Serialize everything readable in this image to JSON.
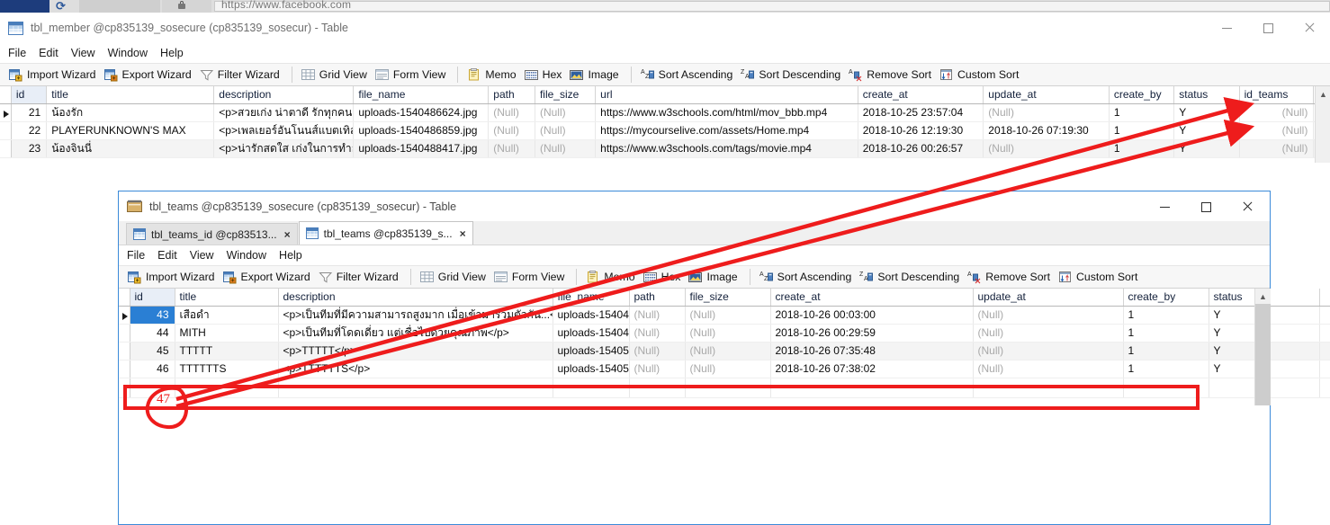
{
  "browser": {
    "url": "https://www.facebook.com"
  },
  "window1": {
    "title": "tbl_member @cp835139_sosecure (cp835139_sosecur) - Table",
    "icon": "table-icon",
    "controls": {
      "minimize": "minimize-icon",
      "maximize": "maximize-icon",
      "close": "close-icon"
    },
    "menu": [
      "File",
      "Edit",
      "View",
      "Window",
      "Help"
    ],
    "toolbar": [
      {
        "label": "Import Wizard",
        "icon": "import-wizard-icon"
      },
      {
        "label": "Export Wizard",
        "icon": "export-wizard-icon"
      },
      {
        "label": "Filter Wizard",
        "icon": "filter-icon"
      },
      {
        "sep": true
      },
      {
        "label": "Grid View",
        "icon": "grid-view-icon"
      },
      {
        "label": "Form View",
        "icon": "form-view-icon"
      },
      {
        "sep": true
      },
      {
        "label": "Memo",
        "icon": "memo-icon"
      },
      {
        "label": "Hex",
        "icon": "hex-icon"
      },
      {
        "label": "Image",
        "icon": "image-icon"
      },
      {
        "sep": true
      },
      {
        "label": "Sort Ascending",
        "icon": "sort-ascending-icon"
      },
      {
        "label": "Sort Descending",
        "icon": "sort-descending-icon"
      },
      {
        "label": "Remove Sort",
        "icon": "remove-sort-icon"
      },
      {
        "label": "Custom Sort",
        "icon": "custom-sort-icon"
      }
    ],
    "grid": {
      "columns": [
        "id",
        "title",
        "description",
        "file_name",
        "path",
        "file_size",
        "url",
        "create_at",
        "update_at",
        "create_by",
        "status",
        "id_teams"
      ],
      "rows": [
        {
          "marker": true,
          "id": "21",
          "title": "น้องรัก",
          "description": "<p>สวยเก่ง น่าตาดี รักทุกคนนะ",
          "file_name": "uploads-1540486624.jpg",
          "path": "(Null)",
          "file_size": "(Null)",
          "url": "https://www.w3schools.com/html/mov_bbb.mp4",
          "create_at": "2018-10-25 23:57:04",
          "update_at": "(Null)",
          "create_by": "1",
          "status": "Y",
          "id_teams": "(Null)"
        },
        {
          "marker": false,
          "id": "22",
          "title": "PLAYERUNKNOWN'S MAX",
          "description": "<p>เพลเยอร์อันโนนส์แบตเทิลกร",
          "file_name": "uploads-1540486859.jpg",
          "path": "(Null)",
          "file_size": "(Null)",
          "url": "https://mycourselive.com/assets/Home.mp4",
          "create_at": "2018-10-26 12:19:30",
          "update_at": "2018-10-26 07:19:30",
          "create_by": "1",
          "status": "Y",
          "id_teams": "(Null)"
        },
        {
          "marker": false,
          "id": "23",
          "title": "น้องจินนี่",
          "description": "<p>น่ารักสดใส เก่งในการทำอาห",
          "file_name": "uploads-1540488417.jpg",
          "path": "(Null)",
          "file_size": "(Null)",
          "url": "https://www.w3schools.com/tags/movie.mp4",
          "create_at": "2018-10-26 00:26:57",
          "update_at": "(Null)",
          "create_by": "1",
          "status": "Y",
          "id_teams": "(Null)"
        }
      ]
    }
  },
  "window2": {
    "title": "tbl_teams @cp835139_sosecure (cp835139_sosecur) - Table",
    "icon": "table-icon",
    "controls": {
      "minimize": "minimize-icon",
      "maximize": "maximize-icon",
      "close": "close-icon"
    },
    "tabs": [
      {
        "label": "tbl_teams_id @cp83513...",
        "active": false,
        "icon": "table-icon",
        "close": "×"
      },
      {
        "label": "tbl_teams @cp835139_s...",
        "active": true,
        "icon": "table-icon",
        "close": "×"
      }
    ],
    "menu": [
      "File",
      "Edit",
      "View",
      "Window",
      "Help"
    ],
    "toolbar": [
      {
        "label": "Import Wizard",
        "icon": "import-wizard-icon"
      },
      {
        "label": "Export Wizard",
        "icon": "export-wizard-icon"
      },
      {
        "label": "Filter Wizard",
        "icon": "filter-icon"
      },
      {
        "sep": true
      },
      {
        "label": "Grid View",
        "icon": "grid-view-icon"
      },
      {
        "label": "Form View",
        "icon": "form-view-icon"
      },
      {
        "sep": true
      },
      {
        "label": "Memo",
        "icon": "memo-icon"
      },
      {
        "label": "Hex",
        "icon": "hex-icon"
      },
      {
        "label": "Image",
        "icon": "image-icon"
      },
      {
        "sep": true
      },
      {
        "label": "Sort Ascending",
        "icon": "sort-ascending-icon"
      },
      {
        "label": "Sort Descending",
        "icon": "sort-descending-icon"
      },
      {
        "label": "Remove Sort",
        "icon": "remove-sort-icon"
      },
      {
        "label": "Custom Sort",
        "icon": "custom-sort-icon"
      }
    ],
    "grid": {
      "columns": [
        "id",
        "title",
        "description",
        "file_name",
        "path",
        "file_size",
        "create_at",
        "update_at",
        "create_by",
        "status"
      ],
      "rows": [
        {
          "marker": true,
          "selected": true,
          "id": "43",
          "title": "เสือดำ",
          "description": "<p>เป็นทีมที่มีความสามารถสูงมาก เมื่อเข้ามารวมตัวกัน...</p>",
          "file_name": "uploads-15404",
          "path": "(Null)",
          "file_size": "(Null)",
          "create_at": "2018-10-26 00:03:00",
          "update_at": "(Null)",
          "create_by": "1",
          "status": "Y"
        },
        {
          "marker": false,
          "selected": false,
          "id": "44",
          "title": "MITH",
          "description": "<p>เป็นทีมที่โดดเดี่ยว แต่เชื่อไปด้วยคุณภาพ</p>",
          "file_name": "uploads-15404",
          "path": "(Null)",
          "file_size": "(Null)",
          "create_at": "2018-10-26 00:29:59",
          "update_at": "(Null)",
          "create_by": "1",
          "status": "Y"
        },
        {
          "marker": false,
          "selected": false,
          "id": "45",
          "title": "TTTTT",
          "description": "<p>TTTTT</p>",
          "file_name": "uploads-15405",
          "path": "(Null)",
          "file_size": "(Null)",
          "create_at": "2018-10-26 07:35:48",
          "update_at": "(Null)",
          "create_by": "1",
          "status": "Y"
        },
        {
          "marker": false,
          "selected": false,
          "id": "46",
          "title": "TTTTTTS",
          "description": "<p>TTTTTTS</p>",
          "file_name": "uploads-15405",
          "path": "(Null)",
          "file_size": "(Null)",
          "create_at": "2018-10-26 07:38:02",
          "update_at": "(Null)",
          "create_by": "1",
          "status": "Y"
        }
      ]
    }
  },
  "annotations": {
    "color": "#ee1c1c",
    "circled_value": "47",
    "note": "red hand-drawn arrows from new row id to id_teams column of upper table"
  }
}
